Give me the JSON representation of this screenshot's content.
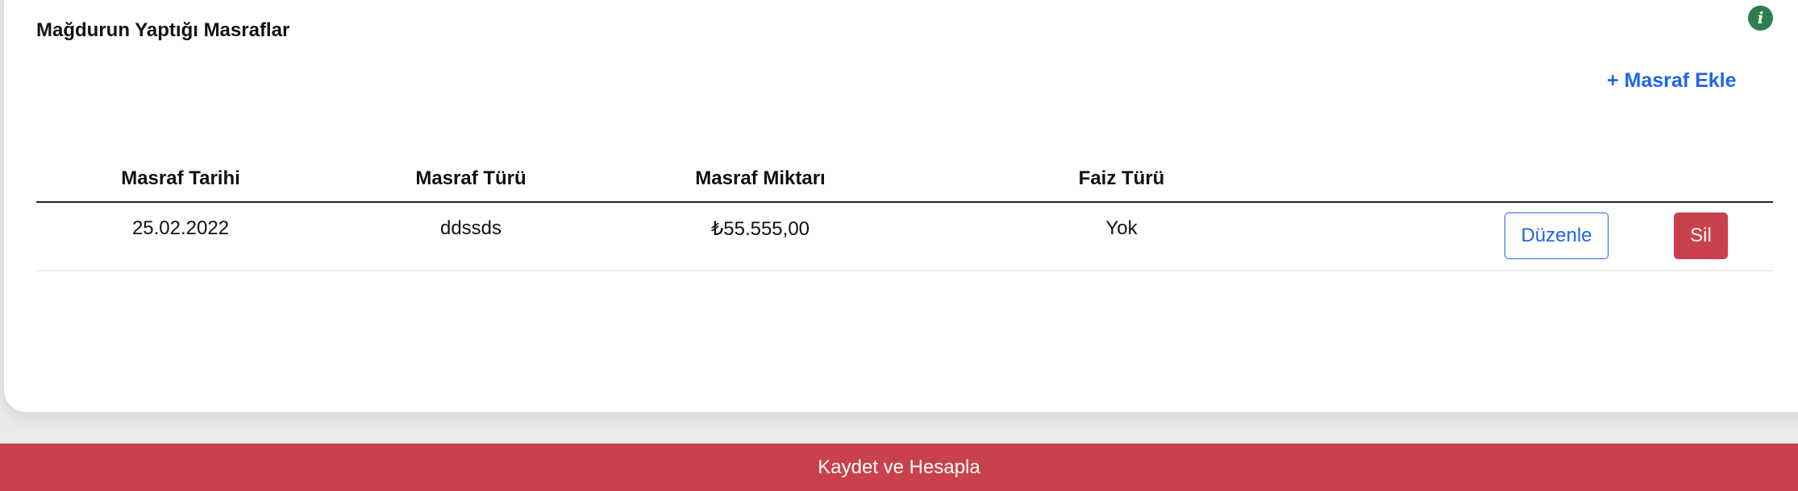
{
  "section": {
    "title": "Mağdurun Yaptığı Masraflar",
    "info_icon_glyph": "i",
    "add_link": "+ Masraf Ekle"
  },
  "table": {
    "headers": [
      "Masraf Tarihi",
      "Masraf Türü",
      "Masraf Miktarı",
      "Faiz Türü"
    ],
    "rows": [
      {
        "date": "25.02.2022",
        "type": "ddssds",
        "amount": "₺55.555,00",
        "interest": "Yok",
        "edit_label": "Düzenle",
        "delete_label": "Sil"
      }
    ]
  },
  "footer": {
    "save_label": "Kaydet ve Hesapla"
  },
  "colors": {
    "accent_blue": "#1f66e5",
    "danger_red": "#c9414a",
    "info_green": "#2e7d4f"
  }
}
